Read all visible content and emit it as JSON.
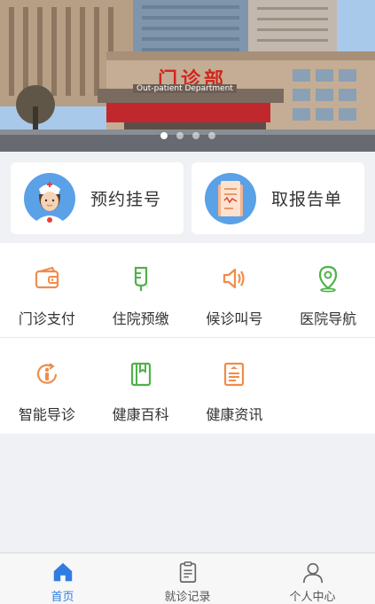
{
  "banner": {
    "sign_main": "门诊部",
    "sign_sub": "Out-patient Department",
    "slide_count": 4,
    "active_slide": 1
  },
  "primary_cards": [
    {
      "label": "预约挂号",
      "icon": "nurse-avatar-icon"
    },
    {
      "label": "取报告单",
      "icon": "report-document-icon"
    }
  ],
  "services": [
    {
      "label": "门诊支付",
      "icon": "wallet-icon",
      "color": "#f08c4c"
    },
    {
      "label": "住院预缴",
      "icon": "iv-drip-icon",
      "color": "#4fb24a"
    },
    {
      "label": "候诊叫号",
      "icon": "speaker-icon",
      "color": "#f08c4c"
    },
    {
      "label": "医院导航",
      "icon": "location-pin-icon",
      "color": "#4fb24a"
    },
    {
      "label": "智能导诊",
      "icon": "smart-guide-icon",
      "color": "#f08c4c"
    },
    {
      "label": "健康百科",
      "icon": "book-icon",
      "color": "#4fb24a"
    },
    {
      "label": "健康资讯",
      "icon": "news-icon",
      "color": "#f08c4c"
    }
  ],
  "tabbar": {
    "items": [
      {
        "label": "首页",
        "icon": "home-icon",
        "active": true
      },
      {
        "label": "就诊记录",
        "icon": "clipboard-icon",
        "active": false
      },
      {
        "label": "个人中心",
        "icon": "user-icon",
        "active": false
      }
    ],
    "active_color": "#2f7de1"
  }
}
